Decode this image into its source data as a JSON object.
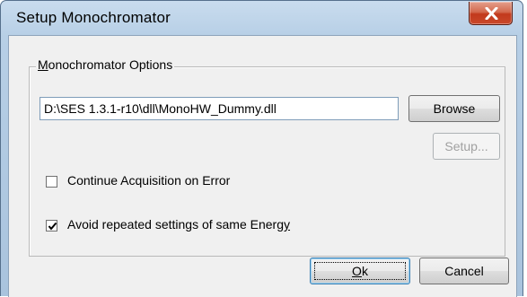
{
  "window": {
    "title": "Setup Monochromator",
    "close_icon": "close-icon"
  },
  "options_group": {
    "legend_prefix": "M",
    "legend_rest": "onochromator Options",
    "dll_path": "D:\\SES 1.3.1-r10\\dll\\MonoHW_Dummy.dll",
    "browse_label": "Browse",
    "setup_label": "Setup...",
    "continue_on_error": {
      "label": "Continue Acquisition on Error",
      "checked": false
    },
    "avoid_repeated": {
      "label_prefix": "Avoid repeated settings of same Energ",
      "label_mnemonic": "y",
      "checked": true
    }
  },
  "buttons": {
    "ok_prefix": "",
    "ok_mnemonic": "O",
    "ok_rest": "k",
    "cancel_label": "Cancel"
  }
}
